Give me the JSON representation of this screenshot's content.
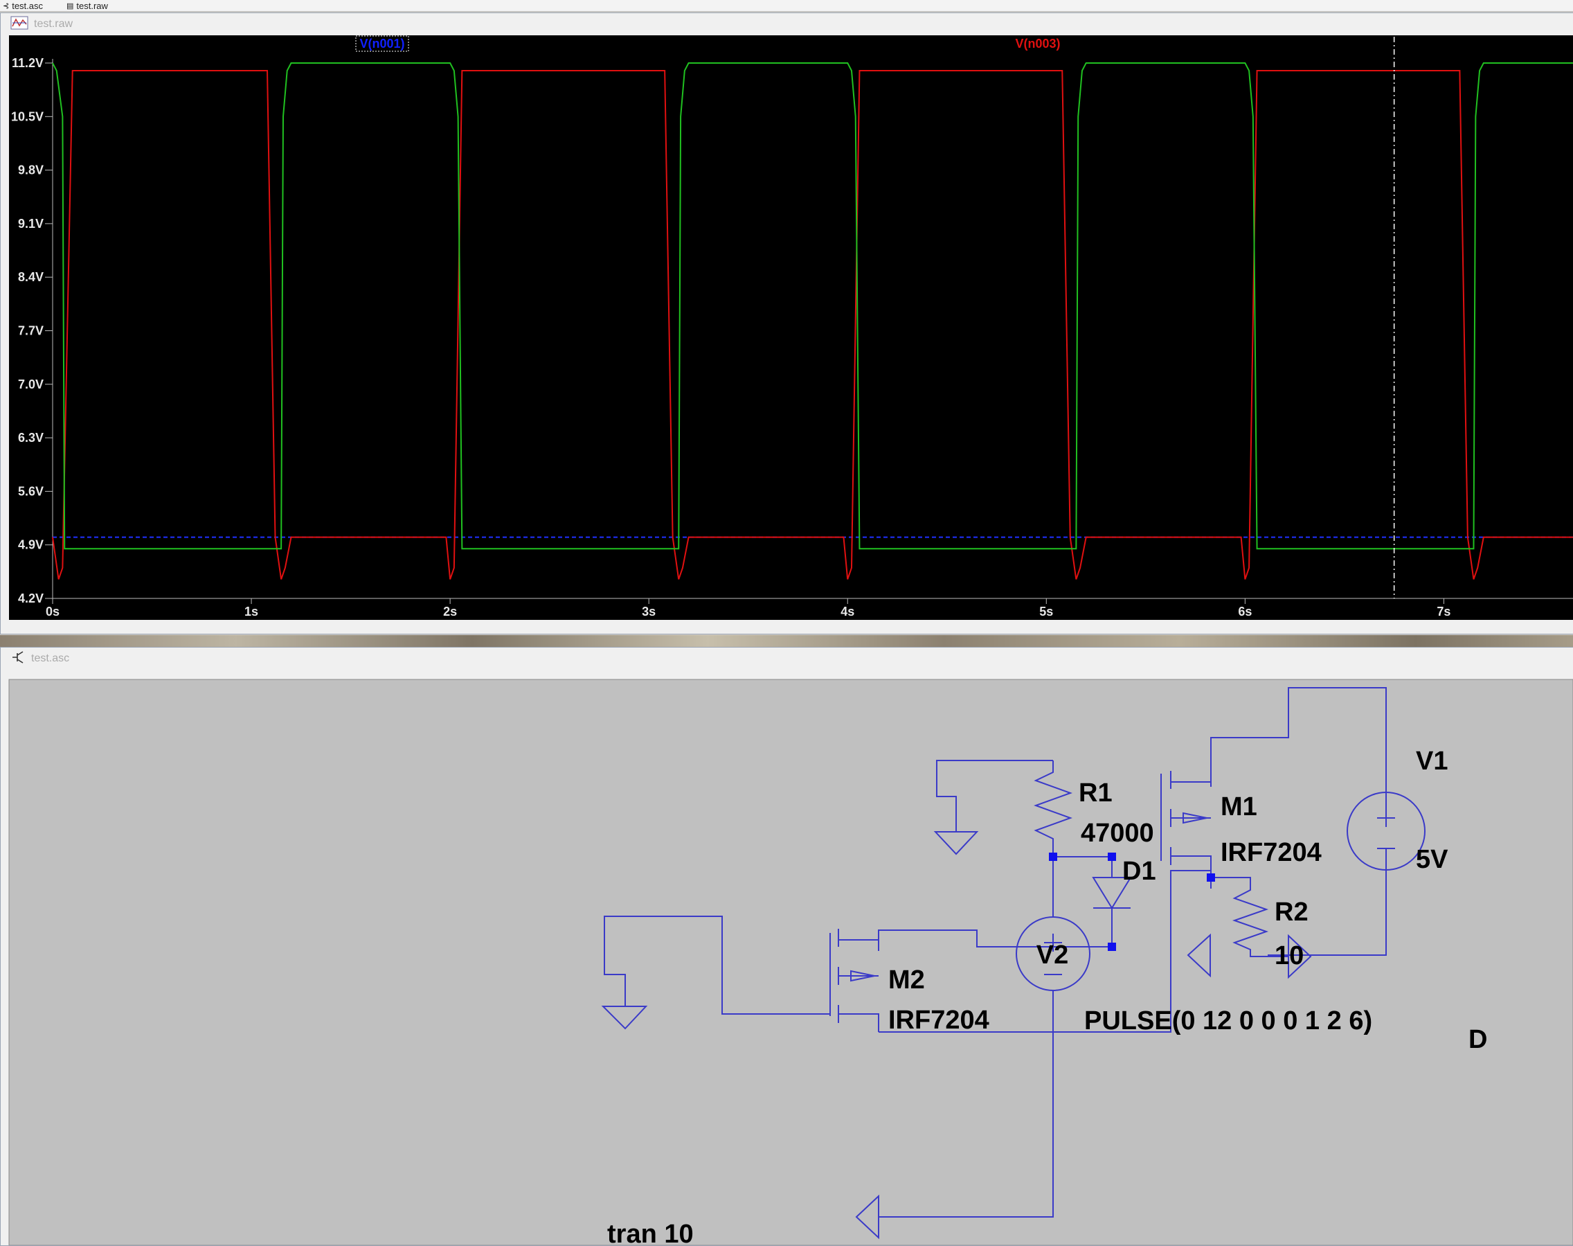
{
  "tabs": [
    {
      "label": "test.asc"
    },
    {
      "label": "test.raw"
    }
  ],
  "plot_window": {
    "title": "test.raw",
    "trace_labels": [
      "V(n001)",
      "V(n003)"
    ]
  },
  "schematic_window": {
    "title": "test.asc",
    "components": {
      "r1": {
        "name": "R1",
        "value": "47000"
      },
      "r2": {
        "name": "R2",
        "value": "10"
      },
      "d1": {
        "name": "D1"
      },
      "m1": {
        "name": "M1",
        "value": "IRF7204"
      },
      "m2": {
        "name": "M2",
        "value": "IRF7204"
      },
      "v1": {
        "name": "V1",
        "value": "5V"
      },
      "v2": {
        "name": "V2",
        "value": "PULSE(0 12 0 0 0 1 2 6)"
      }
    },
    "extra_label": "D",
    "directive": "tran 10"
  },
  "colors": {
    "trace_v_n001": "#1010ff",
    "trace_v_n003": "#e01010",
    "trace_green": "#20c020",
    "wire": "#3333cc",
    "junction": "#0000ff"
  },
  "chart_data": {
    "type": "line",
    "title": "",
    "xlabel": "",
    "ylabel": "",
    "y_ticks": [
      "11.2V",
      "10.5V",
      "9.8V",
      "9.1V",
      "8.4V",
      "7.7V",
      "7.0V",
      "6.3V",
      "5.6V",
      "4.9V",
      "4.2V"
    ],
    "x_ticks": [
      "0s",
      "1s",
      "2s",
      "3s",
      "4s",
      "5s",
      "6s",
      "7s"
    ],
    "xlim": [
      0,
      7.65
    ],
    "ylim": [
      4.2,
      11.2
    ],
    "cursor_x": 6.75,
    "series": [
      {
        "name": "V(n001)",
        "color": "#2030ff",
        "style": "dashed",
        "x": [
          0,
          7.65
        ],
        "y": [
          5.0,
          5.0
        ]
      },
      {
        "name": "V(n003)",
        "color": "#e01010",
        "x": [
          0,
          0.03,
          0.05,
          0.1,
          1.08,
          1.12,
          1.15,
          1.17,
          1.2,
          1.98,
          2.0,
          2.02,
          2.06,
          2.1,
          3.08,
          3.12,
          3.15,
          3.17,
          3.2,
          3.98,
          4.0,
          4.02,
          4.06,
          4.1,
          5.08,
          5.12,
          5.15,
          5.17,
          5.2,
          5.98,
          6.0,
          6.02,
          6.06,
          6.1,
          7.08,
          7.12,
          7.15,
          7.17,
          7.2,
          7.65
        ],
        "y": [
          5.0,
          4.45,
          4.6,
          11.1,
          11.1,
          5.0,
          4.45,
          4.6,
          5.0,
          5.0,
          4.45,
          4.6,
          11.1,
          11.1,
          11.1,
          5.0,
          4.45,
          4.6,
          5.0,
          5.0,
          4.45,
          4.6,
          11.1,
          11.1,
          11.1,
          5.0,
          4.45,
          4.6,
          5.0,
          5.0,
          4.45,
          4.6,
          11.1,
          11.1,
          11.1,
          5.0,
          4.45,
          4.6,
          5.0,
          5.0
        ]
      },
      {
        "color": "#20c020",
        "x": [
          0,
          0.02,
          0.05,
          0.06,
          1.15,
          1.16,
          1.18,
          1.2,
          2.0,
          2.02,
          2.04,
          2.06,
          3.15,
          3.16,
          3.18,
          3.2,
          4.0,
          4.02,
          4.04,
          4.06,
          5.15,
          5.16,
          5.18,
          5.2,
          6.0,
          6.02,
          6.04,
          6.06,
          7.15,
          7.16,
          7.18,
          7.2,
          7.65
        ],
        "y": [
          11.2,
          11.1,
          10.5,
          4.85,
          4.85,
          10.5,
          11.1,
          11.2,
          11.2,
          11.1,
          10.5,
          4.85,
          4.85,
          10.5,
          11.1,
          11.2,
          11.2,
          11.1,
          10.5,
          4.85,
          4.85,
          10.5,
          11.1,
          11.2,
          11.2,
          11.1,
          10.5,
          4.85,
          4.85,
          10.5,
          11.1,
          11.2,
          11.2
        ]
      }
    ]
  }
}
